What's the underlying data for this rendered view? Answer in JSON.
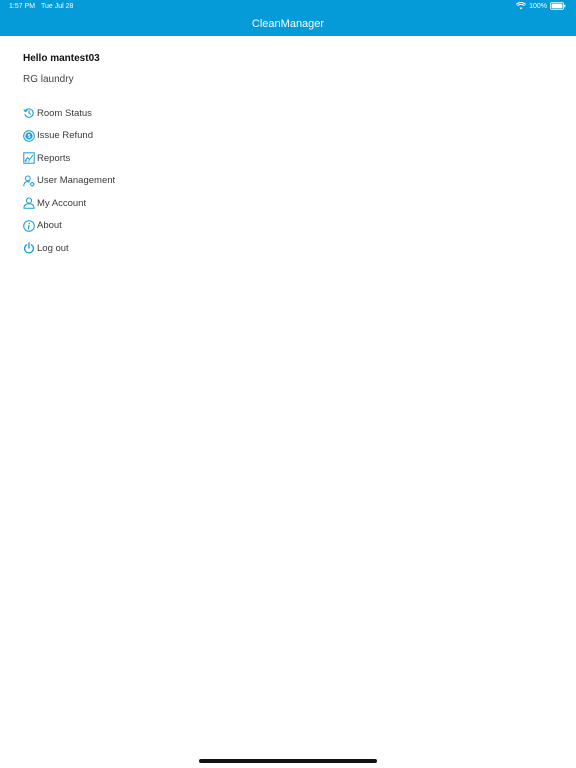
{
  "status_bar": {
    "time": "1:57 PM",
    "date": "Tue Jul 28",
    "battery": "100%"
  },
  "header": {
    "title": "CleanManager"
  },
  "user": {
    "greeting": "Hello mantest03",
    "location": "RG laundry"
  },
  "menu": {
    "items": [
      {
        "label": "Room Status",
        "icon": "history-icon"
      },
      {
        "label": "Issue Refund",
        "icon": "refund-icon"
      },
      {
        "label": "Reports",
        "icon": "chart-icon"
      },
      {
        "label": "User Management",
        "icon": "user-gear-icon"
      },
      {
        "label": "My Account",
        "icon": "user-icon"
      },
      {
        "label": "About",
        "icon": "info-icon"
      },
      {
        "label": "Log out",
        "icon": "power-icon"
      }
    ]
  },
  "colors": {
    "header": "#049bd8",
    "icon": "#1a9bd6",
    "text": "#3a3a3a"
  }
}
